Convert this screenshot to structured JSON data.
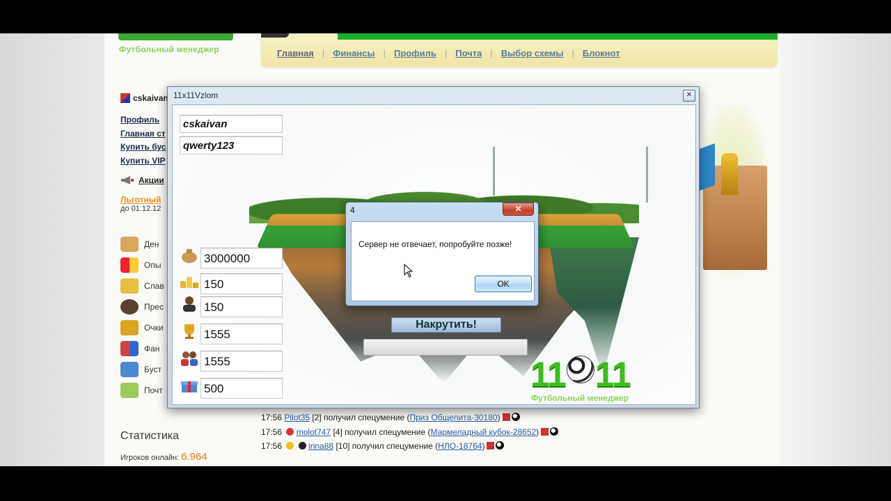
{
  "site": {
    "logo_subtitle": "Футбольный менеджер",
    "nav": {
      "items": [
        "Главная",
        "Финансы",
        "Профиль",
        "Почта",
        "Выбор схемы",
        "Блокнот"
      ],
      "separator": "|"
    },
    "sidebar": {
      "username": "cskaivan",
      "links": [
        "Профиль",
        "Главная ст",
        "Купить бус",
        "Купить VIP"
      ],
      "promo_label": "Акции",
      "discount_label": "Льготный",
      "discount_until": "до 01.12.12",
      "stats": [
        "Ден",
        "Опы",
        "Слав",
        "Прес",
        "Очки",
        "Фан",
        "Буст",
        "Почт"
      ]
    },
    "statistics": {
      "title": "Статистика",
      "online_label": "Игроков онлайн:",
      "online_value": "6.964"
    },
    "feed": [
      {
        "time": "17:56",
        "user": "Pilot35",
        "level": "[2]",
        "text": "получил спецумение",
        "item": "Приз Общепита-30180"
      },
      {
        "time": "17:56",
        "user": "molot747",
        "level": "[4]",
        "text": "получил спецумение",
        "item": "Мармеладный кубок-28652"
      },
      {
        "time": "17:56",
        "user": "irina88",
        "level": "[10]",
        "text": "получил спецумение",
        "item": "НЛО-18764"
      }
    ],
    "colors": {
      "brand_green": "#3aa832",
      "link": "#2a5aa8",
      "accent_orange": "#e67a12"
    }
  },
  "app": {
    "title": "11x11Vzlom",
    "close_glyph": "✕",
    "login": "cskaivan",
    "password": "qwerty123",
    "fields": [
      {
        "icon": "money-bag-icon",
        "value": "3000000"
      },
      {
        "icon": "podium-icon",
        "value": "150"
      },
      {
        "icon": "person-icon",
        "value": "150"
      },
      {
        "icon": "trophy-icon",
        "value": "1555"
      },
      {
        "icon": "fans-icon",
        "value": "1555"
      },
      {
        "icon": "gift-icon",
        "value": "500"
      }
    ],
    "action_button": "Накрутить!",
    "progress": 0,
    "logo_text_left": "11",
    "logo_text_right": "11",
    "logo_subtitle": "Футбольный менеджер"
  },
  "dialog": {
    "title": "4",
    "close_glyph": "✕",
    "message": "Сервер не отвечает, попробуйте позже!",
    "ok_label": "OK"
  }
}
